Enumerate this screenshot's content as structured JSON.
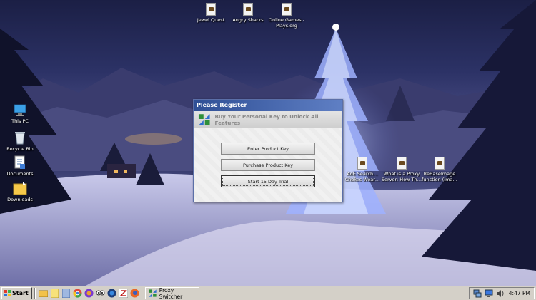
{
  "desktop": {
    "top_icons": [
      {
        "label": "Jewel Quest",
        "icon": "game-shortcut-icon"
      },
      {
        "label": "Angry Sharks",
        "icon": "game-shortcut-icon"
      },
      {
        "label": "Online Games - Plays.org",
        "icon": "game-shortcut-icon"
      }
    ],
    "left_icons": [
      {
        "label": "This PC",
        "icon": "computer-icon"
      },
      {
        "label": "Recycle Bin",
        "icon": "recycle-bin-icon"
      },
      {
        "label": "Documents",
        "icon": "documents-icon"
      },
      {
        "label": "Downloads",
        "icon": "downloads-folder-icon"
      }
    ],
    "right_icons": [
      {
        "label": "AoE Search… Chokes Wear…",
        "icon": "file-icon"
      },
      {
        "label": "What is a Proxy Server: How Th…",
        "icon": "file-icon"
      },
      {
        "label": "ReBaseImage function (ima…",
        "icon": "file-icon"
      }
    ]
  },
  "dialog": {
    "title": "Please Register",
    "banner_text": "Buy Your Personal Key to Unlock All Features",
    "buttons": {
      "enter_key": "Enter Product Key",
      "purchase_key": "Purchase Product Key",
      "trial": "Start 15 Day Trial"
    }
  },
  "taskbar": {
    "start_label": "Start",
    "quick_launch": [
      "folder-icon",
      "notes-icon",
      "files-icon",
      "chrome-icon",
      "browser-icon",
      "owl-icon",
      "ie-icon",
      "z-icon",
      "firefox-icon"
    ],
    "task_label": "Proxy Switcher",
    "clock": "4:47 PM"
  },
  "colors": {
    "titlebar": "#2f4f95",
    "taskbar": "#d4d0c8",
    "banner_text": "#8a8a8a"
  }
}
